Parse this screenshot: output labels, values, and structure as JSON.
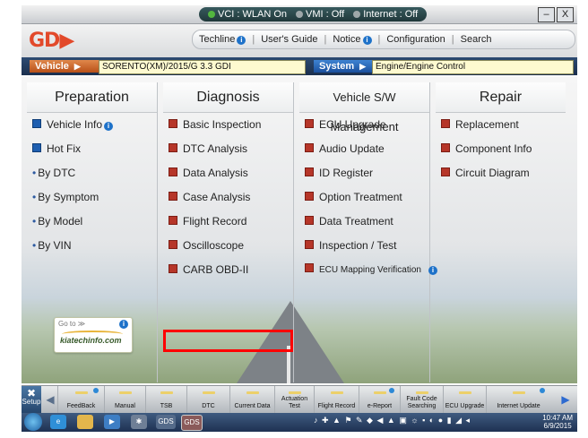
{
  "status_bar": {
    "vci": "VCI : WLAN On",
    "vmi": "VMI : Off",
    "internet": "Internet : Off",
    "minimize": "–",
    "close": "X"
  },
  "header": {
    "logo_text": "GD",
    "nav": [
      {
        "label": "Techline"
      },
      {
        "label": "User's Guide"
      },
      {
        "label": "Notice"
      },
      {
        "label": "Configuration"
      },
      {
        "label": "Search"
      }
    ]
  },
  "vehicle_bar": {
    "vehicle_label": "Vehicle",
    "vehicle_value": "SORENTO(XM)/2015/G 3.3 GDI",
    "system_label": "System",
    "system_value": "Engine/Engine Control"
  },
  "columns": {
    "preparation": {
      "title": "Preparation",
      "items": [
        "Vehicle Info",
        "Hot Fix",
        "By DTC",
        "By Symptom",
        "By Model",
        "By VIN"
      ]
    },
    "diagnosis": {
      "title": "Diagnosis",
      "items": [
        "Basic Inspection",
        "DTC Analysis",
        "Data Analysis",
        "Case Analysis",
        "Flight Record",
        "Oscilloscope",
        "CARB OBD-II"
      ]
    },
    "vehicle_sw": {
      "title": "Vehicle S/W Management",
      "items": [
        "ECU Upgrade",
        "Audio Update",
        "ID Register",
        "Option Treatment",
        "Data Treatment",
        "Inspection / Test",
        "ECU Mapping Verification"
      ]
    },
    "repair": {
      "title": "Repair",
      "items": [
        "Replacement",
        "Component Info",
        "Circuit Diagram"
      ]
    }
  },
  "promo": {
    "goto": "Go to ≫",
    "site": "kiatechinfo.com"
  },
  "toolbar": {
    "setup": "Setup",
    "buttons": [
      "FeedBack",
      "Manual",
      "TSB",
      "DTC",
      "Current Data",
      "Actuation Test",
      "Flight Record",
      "e-Report",
      "Fault Code Searching",
      "ECU Upgrade",
      "Internet Update"
    ]
  },
  "taskbar": {
    "gds1": "GDS",
    "gds2": "GDS",
    "time": "10:47 AM",
    "date": "6/9/2015"
  },
  "colors": {
    "highlight": "#ff0000",
    "vehicle_label": "#c9642a",
    "system_label": "#2c6cc0",
    "green_text": "#2d8a2e"
  }
}
